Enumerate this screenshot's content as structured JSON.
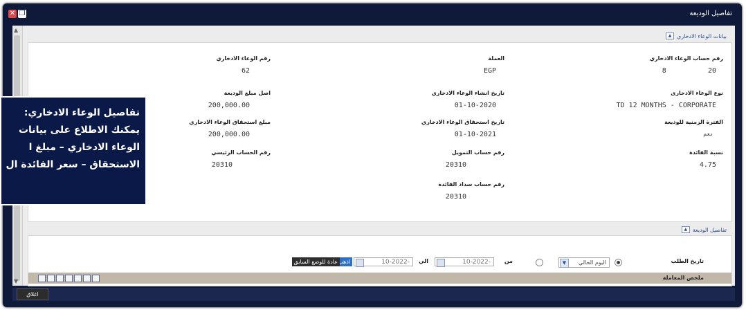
{
  "window": {
    "title": "تفاصيل الوديعة"
  },
  "section1": {
    "title": "بيانات الوعاء الادخاري"
  },
  "fields": {
    "account_no": {
      "label": "رقم حساب الوعاء الادخاري",
      "value": "20          8"
    },
    "currency": {
      "label": "العملة",
      "value": "EGP"
    },
    "vessel_no": {
      "label": "رقم الوعاء الادخاري",
      "value": "62"
    },
    "vessel_type": {
      "label": "نوع الوعاء الادخارى",
      "value": "TD 12 MONTHS - CORPORATE"
    },
    "open_date": {
      "label": "تاريخ انشاء الوعاء الادخاري",
      "value": "01-10-2020"
    },
    "principal": {
      "label": "اصل مبلغ الوديعة",
      "value": "200,000.00"
    },
    "period": {
      "label": "الفترة الزمنية للوديعة",
      "value": "نعم"
    },
    "maturity_date": {
      "label": "تاريخ استحقاق الوعاء الادخاري",
      "value": "01-10-2021"
    },
    "maturity_amount": {
      "label": "مبلغ استحقاق الوعاء الادخاري",
      "value": "200,000.00"
    },
    "interest_rate": {
      "label": "نسبة الفائدة",
      "value": "4.75"
    },
    "funding_account": {
      "label": "رقم حساب التمويل",
      "value": "20310"
    },
    "main_account": {
      "label": "رقم الحساب الرئيسي",
      "value": "20310"
    },
    "interest_payment_account": {
      "label": "رقم حساب سداد الفائدة",
      "value": "20310"
    }
  },
  "section2": {
    "title": "تفاصيل الوديعة",
    "request_date_label": "تاريخ الطلب",
    "current_day_option": "اليوم الحالي",
    "from_label": "من",
    "to_label": "الي",
    "from_date": "-10-2022",
    "to_date": "-10-2022",
    "go_button": "اذهب",
    "reset_button": "عادة للوضع السابق",
    "summary_title": "ملخص المعاملة"
  },
  "buttons": {
    "close": "اغلاق"
  },
  "callout": {
    "line1": "تفاصيل الوعاء الادخاري:",
    "line2": "يمكنك الاطلاع على بيانات",
    "line3": "الوعاء الادخاري – مبلغ ا",
    "line4": "الاستحقاق – سعر الفائدة ال"
  },
  "colors": {
    "window_bg": "#0f1a3a",
    "callout_bg": "#0b1949",
    "summary_bar": "#c2b8a9",
    "link": "#2f4f93"
  }
}
